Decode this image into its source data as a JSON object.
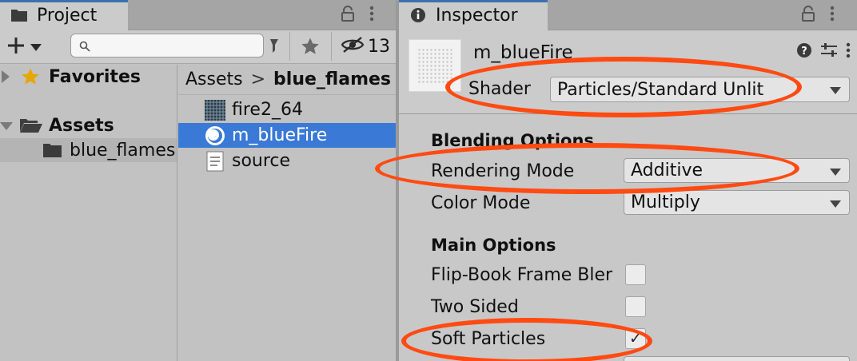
{
  "project": {
    "tab_title": "Project",
    "hidden_count": "13",
    "search_placeholder": "",
    "tree": [
      {
        "label": "Favorites",
        "icon": "star-icon",
        "expanded": false
      },
      {
        "label": "Assets",
        "icon": "folder-open-icon",
        "expanded": true
      },
      {
        "label": "blue_flames",
        "icon": "folder-icon",
        "selected": true
      }
    ],
    "breadcrumb": {
      "root": "Assets",
      "separator": ">",
      "current": "blue_flames"
    },
    "files": [
      {
        "label": "fire2_64",
        "icon": "texture-icon"
      },
      {
        "label": "m_blueFire",
        "icon": "material-icon",
        "selected": true
      },
      {
        "label": "source",
        "icon": "document-icon"
      }
    ]
  },
  "inspector": {
    "tab_title": "Inspector",
    "object_name": "m_blueFire",
    "shader_label": "Shader",
    "shader_value": "Particles/Standard Unlit",
    "sections": {
      "blending": "Blending Options",
      "main": "Main Options"
    },
    "rendering_mode_label": "Rendering Mode",
    "rendering_mode_value": "Additive",
    "color_mode_label": "Color Mode",
    "color_mode_value": "Multiply",
    "flipbook_label": "Flip-Book Frame Bler",
    "flipbook_checked": false,
    "two_sided_label": "Two Sided",
    "two_sided_checked": false,
    "soft_particles_label": "Soft Particles",
    "soft_particles_checked": true,
    "checkmark_glyph": "✓"
  },
  "colors": {
    "highlight_ring": "#ff4a12",
    "selection": "#3a7ad6",
    "tab_accent": "#3a72b0"
  }
}
